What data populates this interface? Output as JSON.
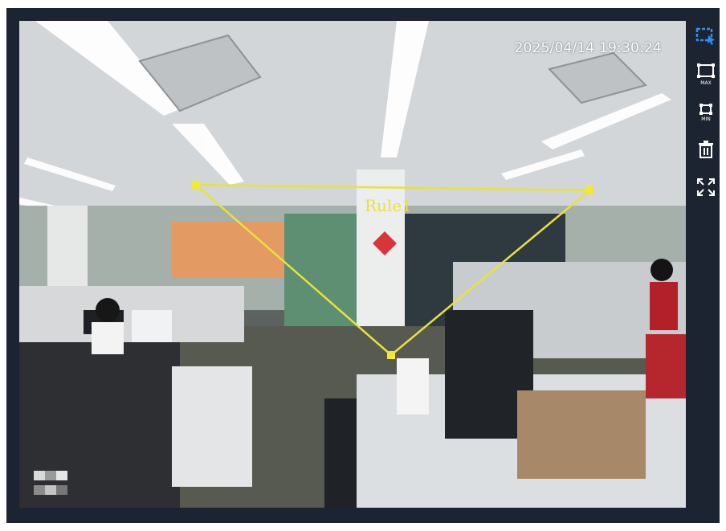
{
  "timestamp": "2025/04/14 19:30:24",
  "rule": {
    "label": "Rule1",
    "color": "#e8e33a"
  },
  "toolbar": {
    "items": [
      {
        "icon": "draw-region-icon",
        "label": "",
        "active": true
      },
      {
        "icon": "max-size-icon",
        "label": "MAX"
      },
      {
        "icon": "min-size-icon",
        "label": "MIN"
      },
      {
        "icon": "delete-icon",
        "label": ""
      },
      {
        "icon": "fullscreen-icon",
        "label": ""
      }
    ]
  },
  "colors": {
    "frame": "#1c2331",
    "accent": "#2f8ff0",
    "rule_line": "#e8e33a"
  }
}
